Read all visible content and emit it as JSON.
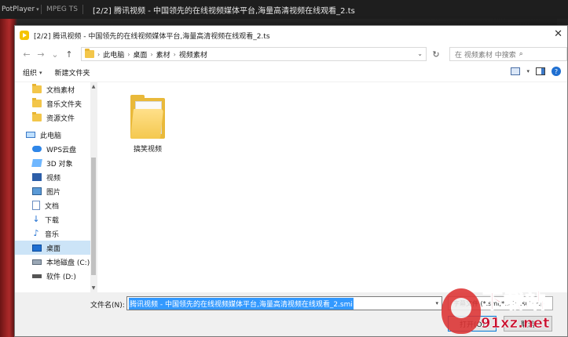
{
  "player": {
    "brand": "PotPlayer",
    "format": "MPEG TS",
    "title": "[2/2] 腾讯视频 - 中国领先的在线视频媒体平台,海量高清视频在线观看_2.ts"
  },
  "dialog": {
    "title": "[2/2] 腾讯视频 - 中国领先的在线视频媒体平台,海量高清视频在线观看_2.ts",
    "close_glyph": "✕",
    "nav": {
      "back": "←",
      "forward": "→",
      "recent": "⌄",
      "up": "↑"
    },
    "breadcrumbs": [
      "此电脑",
      "桌面",
      "素材",
      "视频素材"
    ],
    "refresh_glyph": "↻",
    "search_placeholder": "在 视频素材 中搜索",
    "toolbar": {
      "organize": "组织",
      "new_folder": "新建文件夹"
    },
    "sidebar": {
      "quick": [
        "文档素材",
        "音乐文件夹",
        "资源文件"
      ],
      "pc_label": "此电脑",
      "pc_items": [
        "WPS云盘",
        "3D 对象",
        "视频",
        "图片",
        "文档",
        "下载",
        "音乐",
        "桌面",
        "本地磁盘 (C:)",
        "软件 (D:)"
      ],
      "selected": "桌面"
    },
    "files": [
      {
        "name": "搞笑视频",
        "icon": "folder-icon"
      }
    ],
    "footer": {
      "filename_label": "文件名(N):",
      "filename_value": "腾讯视频 - 中国领先的在线视频媒体平台,海量高清视频在线观看_2.smi",
      "filter": "字幕文件 (*.smi;*.srt;*.sub;*.p",
      "open": "打开(O)",
      "cancel": "取消"
    }
  },
  "watermark": {
    "top": "下载站",
    "bottom": "91xz.net"
  },
  "colors": {
    "selection": "#3399ff",
    "nav_selected": "#cce4f7",
    "folder": "#f3c64a",
    "watermark": "#c8102e"
  }
}
